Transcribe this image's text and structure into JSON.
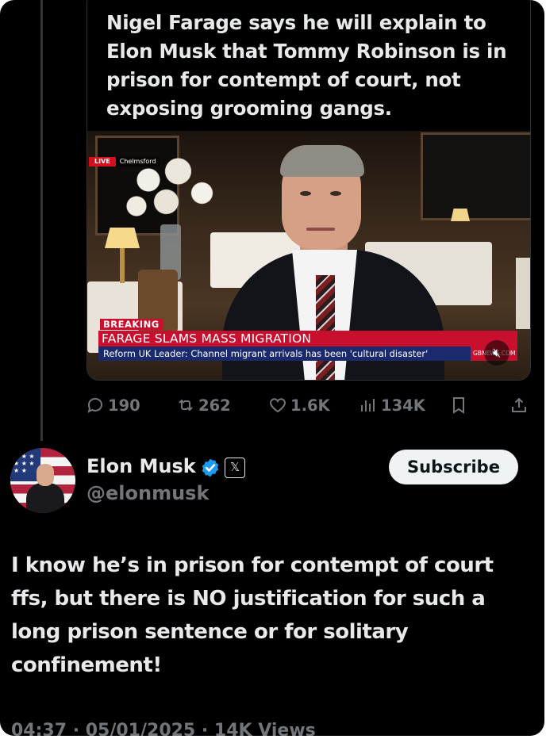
{
  "quoted_post": {
    "text": "Nigel Farage says he will explain to Elon Musk that Tommy Robinson is in prison for contempt of court, not exposing grooming gangs.",
    "video": {
      "live_label": "LIVE",
      "location": "Chelmsford",
      "breaking_label": "BREAKING",
      "headline": "FARAGE SLAMS MASS MIGRATION",
      "subline": "Reform UK Leader: Channel migrant arrivals has been 'cultural disaster'",
      "channel_logo": "GBNEWS.COM",
      "muted": true
    }
  },
  "actions": {
    "replies": "190",
    "reposts": "262",
    "likes": "1.6K",
    "views": "134K"
  },
  "author": {
    "name": "Elon Musk",
    "handle": "@elonmusk",
    "verified_color": "#1d9bf0",
    "affiliate_badge": "𝕏"
  },
  "subscribe_label": "Subscribe",
  "post": {
    "text": "I know he’s in prison for contempt of court ffs, but there is NO justification for such a long prison sentence or for solitary confinement!",
    "meta": "04:37 · 05/01/2025 · 14K Views"
  }
}
